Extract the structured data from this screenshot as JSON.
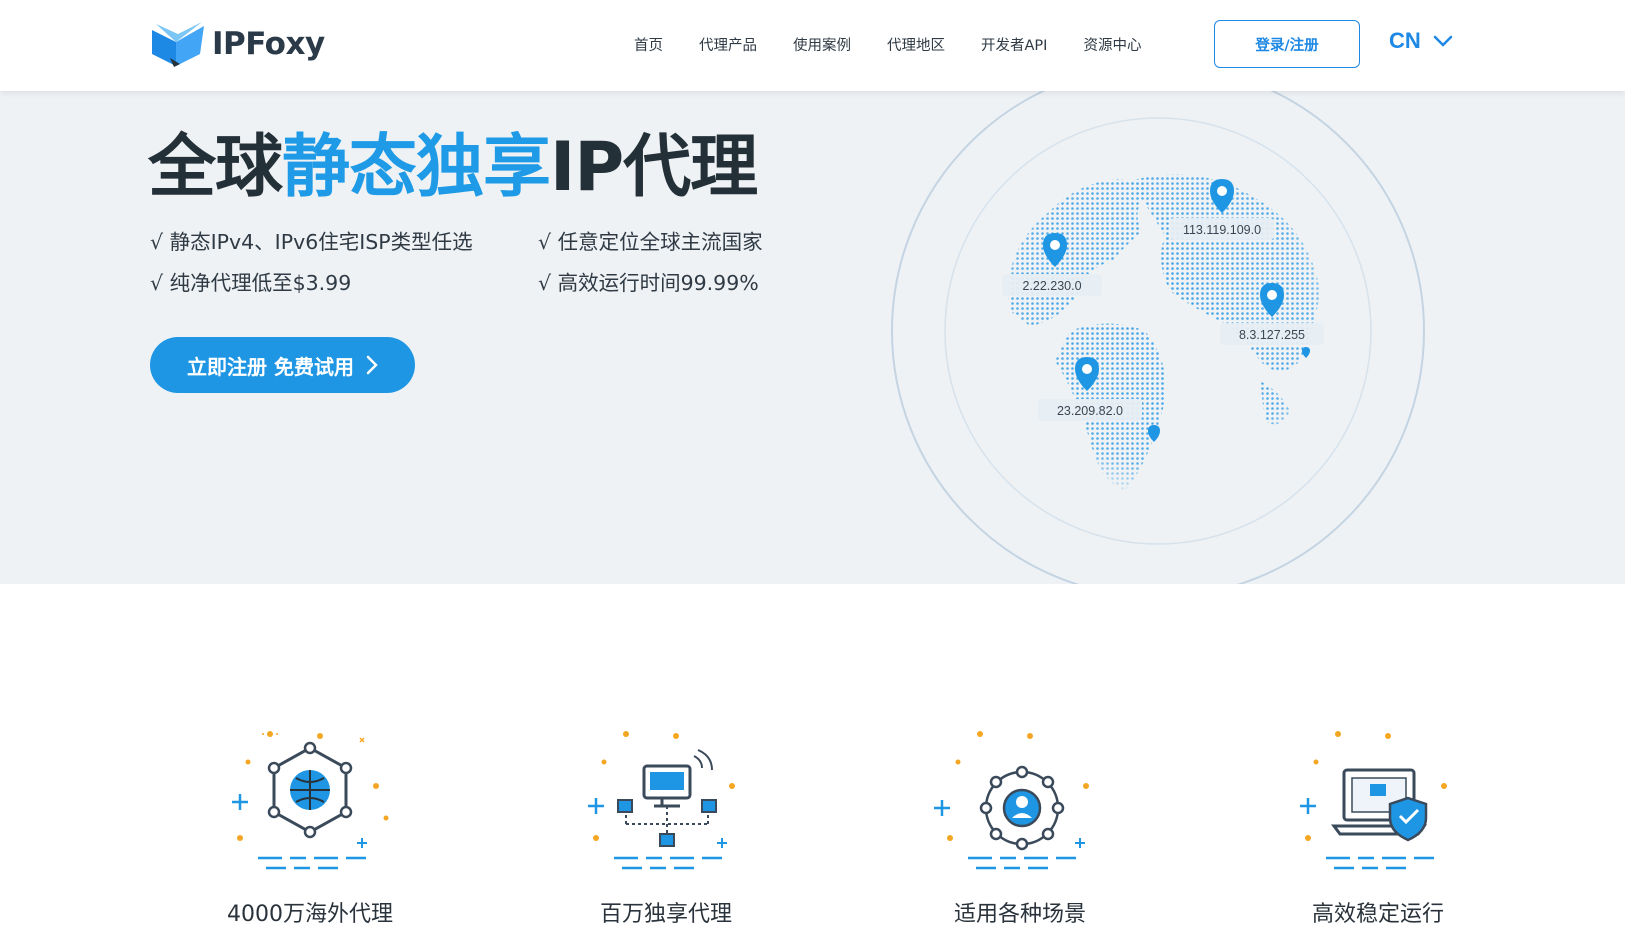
{
  "header": {
    "brand": "IPFoxy",
    "nav": [
      "首页",
      "代理产品",
      "使用案例",
      "代理地区",
      "开发者API",
      "资源中心"
    ],
    "login_label": "登录/注册",
    "language": "CN"
  },
  "hero": {
    "title_prefix": "全球",
    "title_accent": "静态独享",
    "title_suffix": "IP代理",
    "features": [
      "√ 静态IPv4、IPv6住宅ISP类型任选",
      "√ 任意定位全球主流国家",
      "√ 纯净代理低至$3.99",
      "√ 高效运行时间99.99%"
    ],
    "cta_label": "立即注册 免费试用",
    "globe_ips": [
      "113.119.109.0",
      "2.22.230.0",
      "8.3.127.255",
      "23.209.82.0"
    ]
  },
  "features": [
    {
      "label": "4000万海外代理",
      "icon": "globe-network-icon"
    },
    {
      "label": "百万独享代理",
      "icon": "monitor-network-icon"
    },
    {
      "label": "适用各种场景",
      "icon": "user-network-icon"
    },
    {
      "label": "高效稳定运行",
      "icon": "laptop-shield-icon"
    }
  ],
  "colors": {
    "accent": "#1e96e4",
    "hero_bg": "#eef2f5",
    "orange": "#f5a623"
  }
}
